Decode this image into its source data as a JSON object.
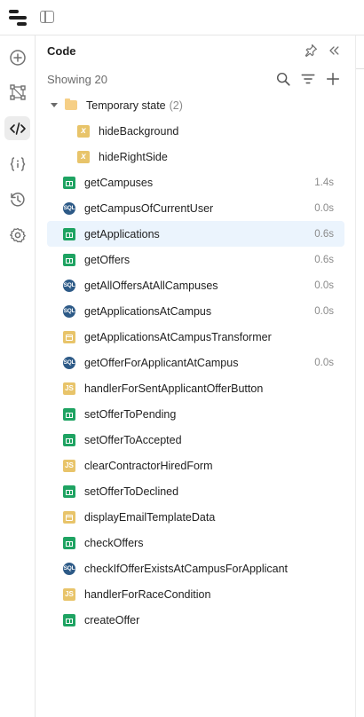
{
  "panel": {
    "title": "Code",
    "showing": "Showing 20"
  },
  "colors": {
    "selected_row": "#ebf4fd",
    "sheet": "#1ea362",
    "sql": "#2d5a87",
    "js": "#e8c46a",
    "folder": "#f6cf86"
  },
  "folder": {
    "name": "Temporary state",
    "count": "(2)",
    "expanded": true
  },
  "variables": [
    {
      "name": "hideBackground",
      "icon": "variable-icon"
    },
    {
      "name": "hideRightSide",
      "icon": "variable-icon"
    }
  ],
  "queries": [
    {
      "name": "getCampuses",
      "type": "sheet",
      "time": "1.4s"
    },
    {
      "name": "getCampusOfCurrentUser",
      "type": "sql",
      "time": "0.0s"
    },
    {
      "name": "getApplications",
      "type": "sheet",
      "time": "0.6s",
      "selected": true
    },
    {
      "name": "getOffers",
      "type": "sheet",
      "time": "0.6s"
    },
    {
      "name": "getAllOffersAtAllCampuses",
      "type": "sql",
      "time": "0.0s"
    },
    {
      "name": "getApplicationsAtCampus",
      "type": "sql",
      "time": "0.0s"
    },
    {
      "name": "getApplicationsAtCampusTransformer",
      "type": "transformer",
      "time": ""
    },
    {
      "name": "getOfferForApplicantAtCampus",
      "type": "sql",
      "time": "0.0s"
    },
    {
      "name": "handlerForSentApplicantOfferButton",
      "type": "js",
      "time": ""
    },
    {
      "name": "setOfferToPending",
      "type": "sheet",
      "time": ""
    },
    {
      "name": "setOfferToAccepted",
      "type": "sheet",
      "time": ""
    },
    {
      "name": "clearContractorHiredForm",
      "type": "js",
      "time": ""
    },
    {
      "name": "setOfferToDeclined",
      "type": "sheet",
      "time": ""
    },
    {
      "name": "displayEmailTemplateData",
      "type": "transformer",
      "time": ""
    },
    {
      "name": "checkOffers",
      "type": "sheet",
      "time": ""
    },
    {
      "name": "checkIfOfferExistsAtCampusForApplicant",
      "type": "sql",
      "time": ""
    },
    {
      "name": "handlerForRaceCondition",
      "type": "js",
      "time": ""
    },
    {
      "name": "createOffer",
      "type": "sheet",
      "time": ""
    }
  ],
  "badge_text": {
    "sql": "SQL",
    "js": "JS",
    "var": "x"
  },
  "rail": [
    "add-icon",
    "workflow-icon",
    "code-icon",
    "state-icon",
    "history-icon",
    "settings-icon"
  ]
}
